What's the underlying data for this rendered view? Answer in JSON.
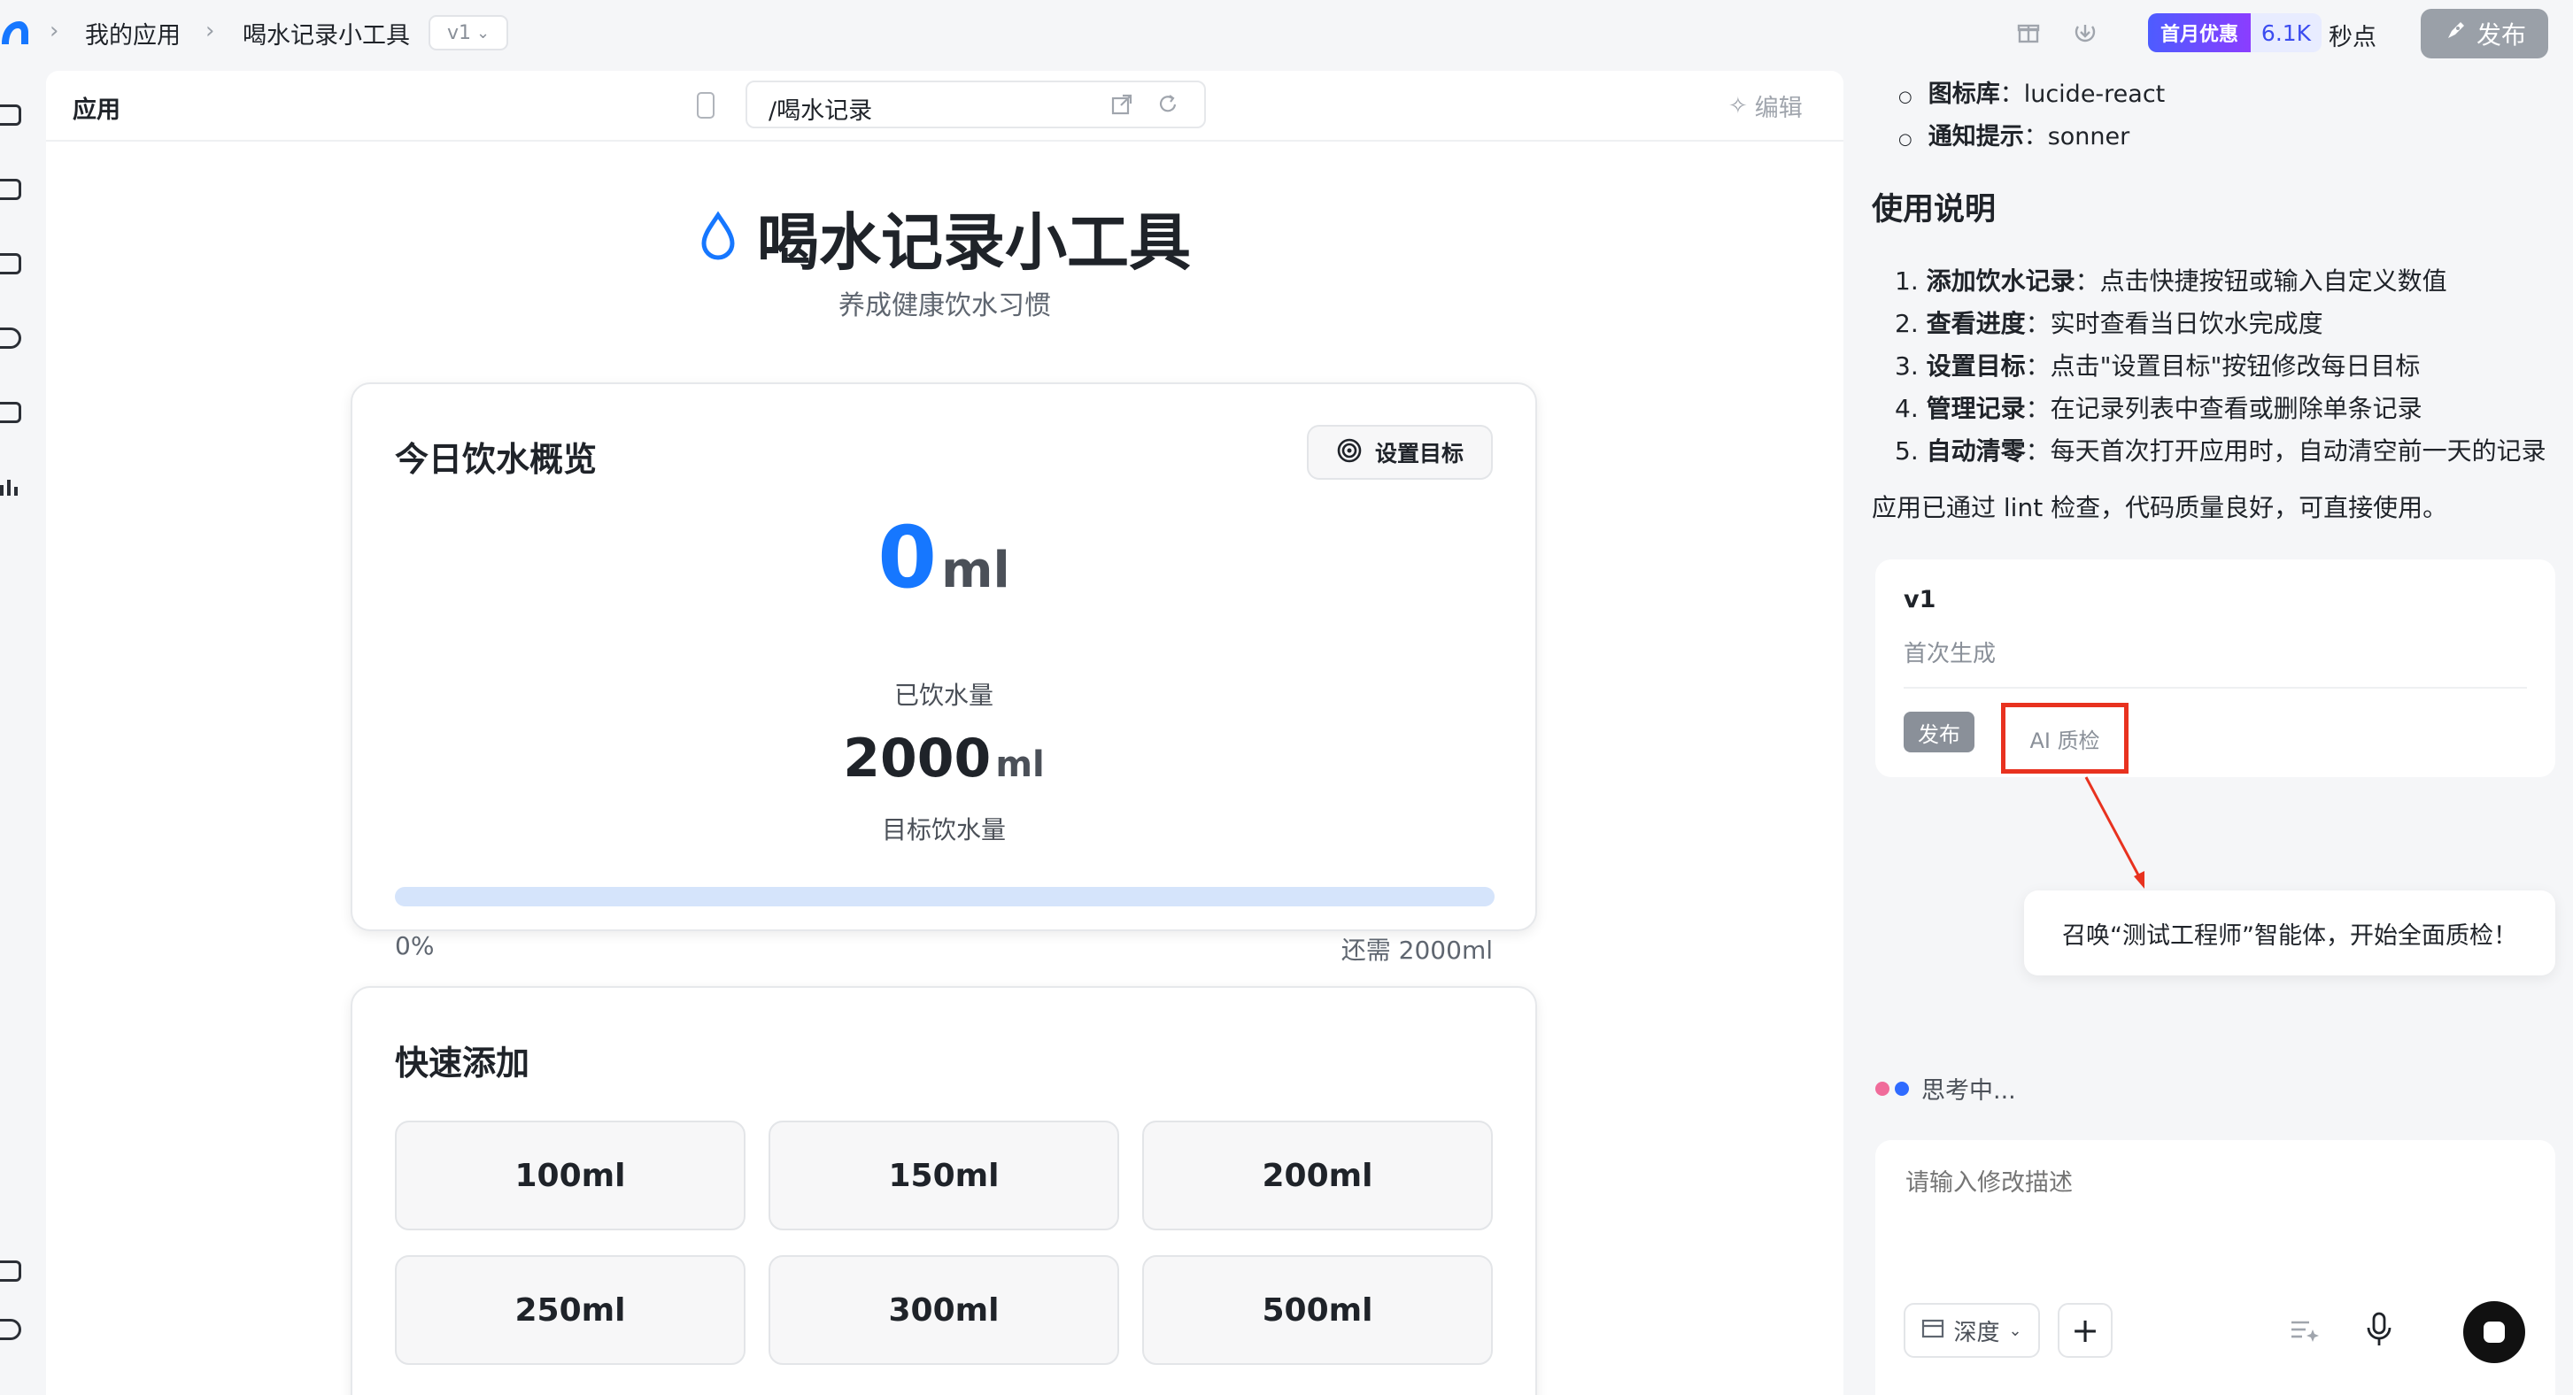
{
  "breadcrumb": {
    "root": "我的应用",
    "current": "喝水记录小工具",
    "version": "v1"
  },
  "topbar": {
    "promo_label": "首月优惠",
    "promo_value": "6.1K",
    "promo_unit": "秒点",
    "publish": "发布"
  },
  "preview": {
    "panel_title": "应用",
    "url": "/喝水记录",
    "edit_label": "编辑",
    "app_title": "喝水记录小工具",
    "app_subtitle": "养成健康饮水习惯",
    "overview": {
      "title": "今日饮水概览",
      "set_goal": "设置目标",
      "drunk_value": "0",
      "drunk_unit": "ml",
      "drunk_label": "已饮水量",
      "goal_value": "2000",
      "goal_unit": "ml",
      "goal_label": "目标饮水量",
      "progress_percent": "0%",
      "remaining": "还需 2000ml",
      "progress_fraction": 0
    },
    "quick_add": {
      "title": "快速添加",
      "buttons": [
        "100ml",
        "150ml",
        "200ml",
        "250ml",
        "300ml",
        "500ml"
      ]
    }
  },
  "right": {
    "libs": [
      {
        "label": "图标库",
        "value": "lucide-react"
      },
      {
        "label": "通知提示",
        "value": "sonner"
      }
    ],
    "usage_title": "使用说明",
    "usage": [
      {
        "n": "1.",
        "bold": "添加饮水记录",
        "text": "：点击快捷按钮或输入自定义数值"
      },
      {
        "n": "2.",
        "bold": "查看进度",
        "text": "：实时查看当日饮水完成度"
      },
      {
        "n": "3.",
        "bold": "设置目标",
        "text": "：点击\"设置目标\"按钮修改每日目标"
      },
      {
        "n": "4.",
        "bold": "管理记录",
        "text": "：在记录列表中查看或删除单条记录"
      },
      {
        "n": "5.",
        "bold": "自动清零",
        "text": "：每天首次打开应用时，自动清空前一天的记录"
      }
    ],
    "lint_note": "应用已通过 lint 检查，代码质量良好，可直接使用。",
    "version_card": {
      "version": "v1",
      "desc": "首次生成",
      "publish": "发布",
      "ai_check": "AI 质检"
    },
    "tooltip": "召唤“测试工程师”智能体，开始全面质检！",
    "thinking": "思考中...",
    "input_placeholder": "请输入修改描述",
    "mode_label": "深度"
  },
  "colors": {
    "accent": "#1677ff",
    "highlight": "#e8321f",
    "progress_track": "#d5e4fb"
  }
}
